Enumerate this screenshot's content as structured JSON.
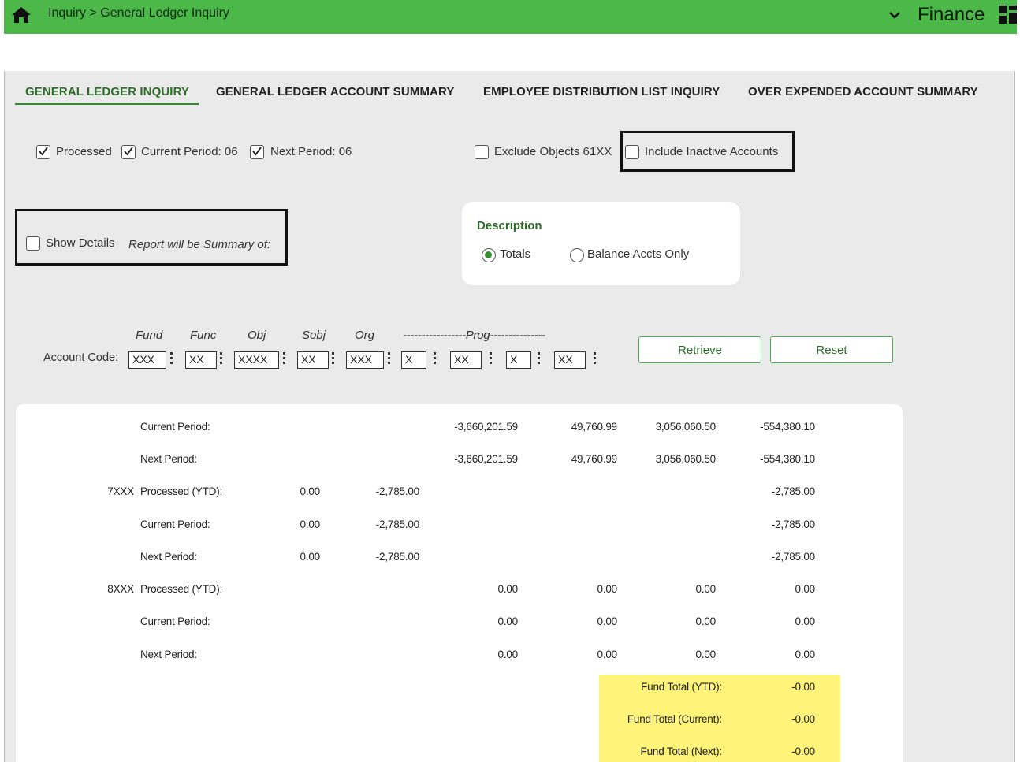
{
  "header": {
    "breadcrumb": "Inquiry > General Ledger Inquiry",
    "app_name": "Finance",
    "brand_color": "#4cb84a"
  },
  "tabs": [
    {
      "label": "GENERAL LEDGER INQUIRY",
      "active": true
    },
    {
      "label": "GENERAL LEDGER ACCOUNT SUMMARY",
      "active": false
    },
    {
      "label": "EMPLOYEE DISTRIBUTION LIST INQUIRY",
      "active": false
    },
    {
      "label": "OVER EXPENDED ACCOUNT SUMMARY",
      "active": false
    }
  ],
  "filters": {
    "processed": {
      "label": "Processed",
      "checked": true
    },
    "current_period": {
      "label": "Current Period: 06",
      "checked": true
    },
    "next_period": {
      "label": "Next Period: 06",
      "checked": true
    },
    "exclude_objects": {
      "label": "Exclude Objects 61XX",
      "checked": false
    },
    "include_inactive": {
      "label": "Include Inactive Accounts",
      "checked": false
    },
    "show_details": {
      "label": "Show Details",
      "checked": false
    },
    "summary_note": "Report will be Summary of:"
  },
  "description": {
    "title": "Description",
    "options": [
      {
        "label": "Totals",
        "selected": true
      },
      {
        "label": "Balance Accts Only",
        "selected": false
      }
    ]
  },
  "account_code": {
    "label": "Account Code:",
    "segment_labels": {
      "fund": "Fund",
      "func": "Func",
      "obj": "Obj",
      "sobj": "Sobj",
      "org": "Org",
      "prog": "-----------------Prog---------------"
    },
    "segments": [
      "XXX",
      "XX",
      "XXXX",
      "XX",
      "XXX",
      "X",
      "XX",
      "X",
      "XX"
    ]
  },
  "buttons": {
    "retrieve": "Retrieve",
    "reset": "Reset"
  },
  "results": {
    "rows": [
      {
        "group": "",
        "label": "Current Period:",
        "c1": "",
        "c2": "",
        "c3": "-3,660,201.59",
        "c4": "49,760.99",
        "c5": "3,056,060.50",
        "c6": "-554,380.10"
      },
      {
        "group": "",
        "label": "Next Period:",
        "c1": "",
        "c2": "",
        "c3": "-3,660,201.59",
        "c4": "49,760.99",
        "c5": "3,056,060.50",
        "c6": "-554,380.10"
      },
      {
        "group": "7XXX",
        "label": "Processed (YTD):",
        "c1": "0.00",
        "c2": "-2,785.00",
        "c3": "",
        "c4": "",
        "c5": "",
        "c6": "-2,785.00"
      },
      {
        "group": "",
        "label": "Current Period:",
        "c1": "0.00",
        "c2": "-2,785.00",
        "c3": "",
        "c4": "",
        "c5": "",
        "c6": "-2,785.00"
      },
      {
        "group": "",
        "label": "Next Period:",
        "c1": "0.00",
        "c2": "-2,785.00",
        "c3": "",
        "c4": "",
        "c5": "",
        "c6": "-2,785.00"
      },
      {
        "group": "8XXX",
        "label": "Processed (YTD):",
        "c1": "",
        "c2": "",
        "c3": "0.00",
        "c4": "0.00",
        "c5": "0.00",
        "c6": "0.00"
      },
      {
        "group": "",
        "label": "Current Period:",
        "c1": "",
        "c2": "",
        "c3": "0.00",
        "c4": "0.00",
        "c5": "0.00",
        "c6": "0.00"
      },
      {
        "group": "",
        "label": "Next Period:",
        "c1": "",
        "c2": "",
        "c3": "0.00",
        "c4": "0.00",
        "c5": "0.00",
        "c6": "0.00"
      }
    ],
    "fund_totals": [
      {
        "label": "Fund Total (YTD):",
        "value": "-0.00"
      },
      {
        "label": "Fund Total (Current):",
        "value": "-0.00"
      },
      {
        "label": "Fund Total (Next):",
        "value": "-0.00"
      }
    ],
    "highlight_color": "#fff37a"
  }
}
